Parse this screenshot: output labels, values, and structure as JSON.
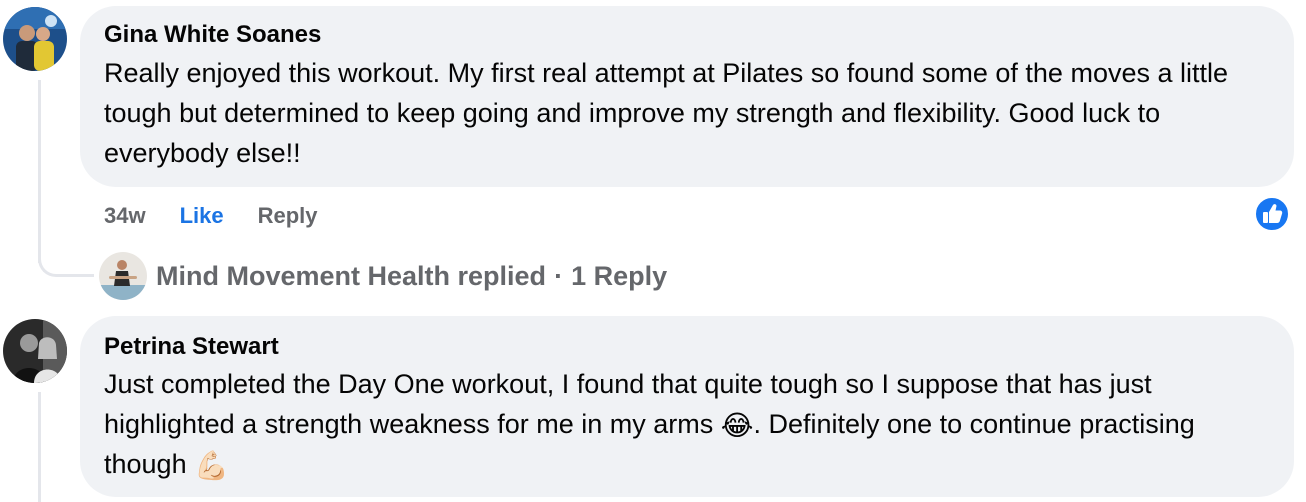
{
  "comments": [
    {
      "author": "Gina White Soanes",
      "text": "Really enjoyed this workout. My first real attempt at Pilates so found some of the moves a little tough but determined to keep going and improve my strength and flexibility. Good luck to everybody else!!",
      "time": "34w",
      "like_label": "Like",
      "reply_label": "Reply",
      "reaction": "like-icon",
      "replies_summary": {
        "name": "Mind Movement Health replied",
        "separator": "·",
        "count_label": "1 Reply"
      }
    },
    {
      "author": "Petrina Stewart",
      "text_part1": "Just completed the Day One workout, I found that quite tough so I suppose that has just highlighted a strength weakness for me in my arms ",
      "emoji1": "😂",
      "text_part2": ". Definitely one to continue practising though ",
      "emoji2": "💪🏻"
    }
  ],
  "colors": {
    "bubble": "#f0f2f5",
    "like_blue": "#1b74e4",
    "muted": "#65676b"
  }
}
